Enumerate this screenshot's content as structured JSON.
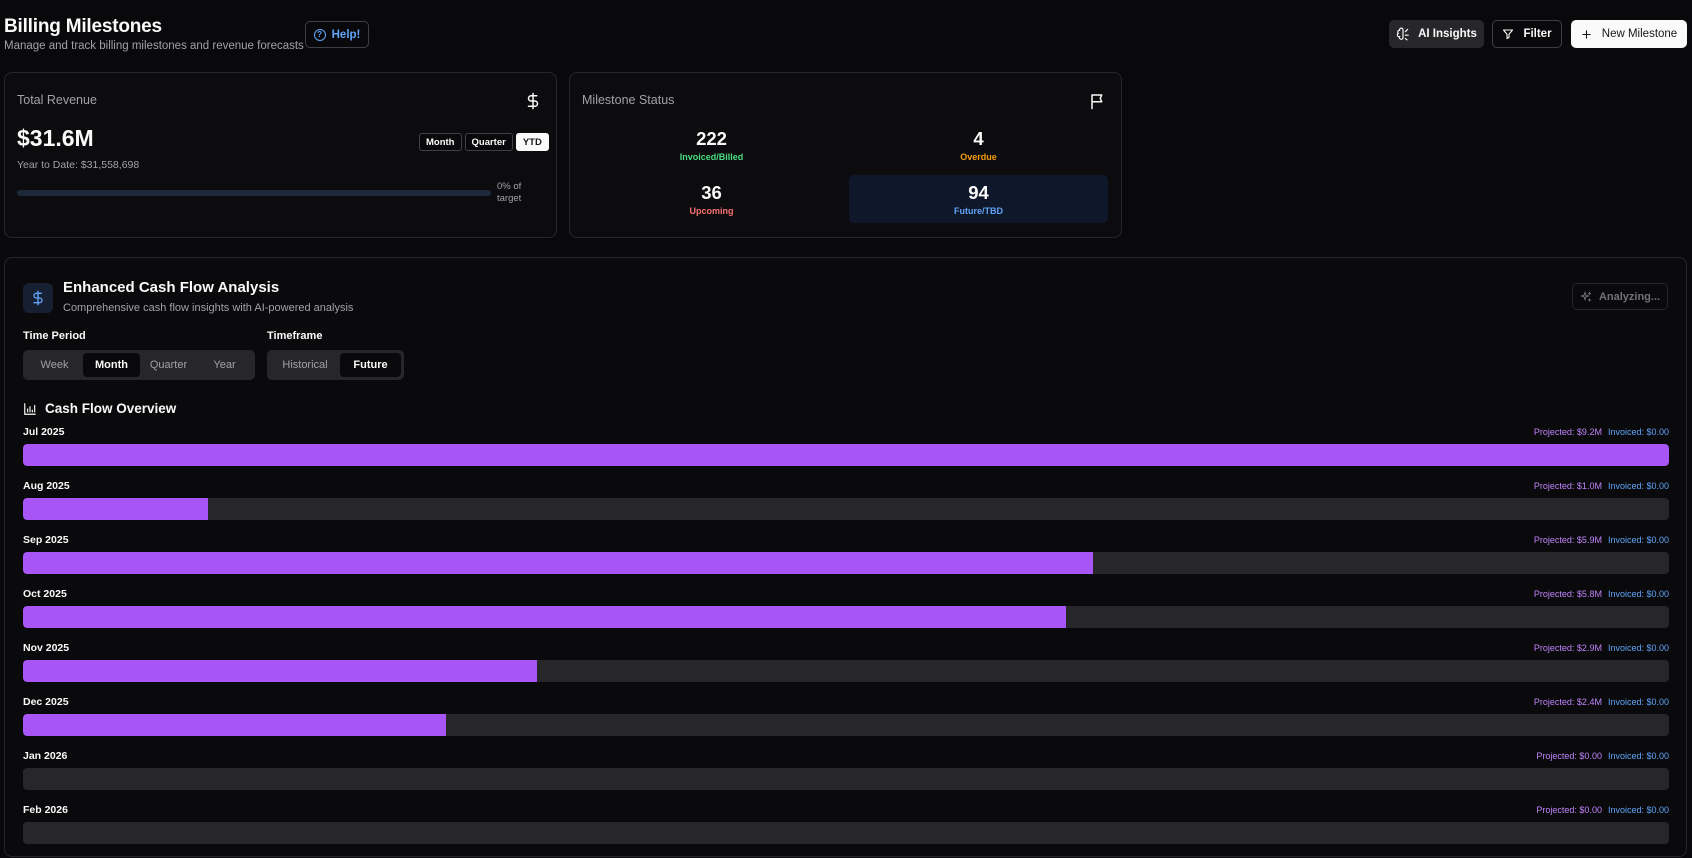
{
  "header": {
    "title": "Billing Milestones",
    "subtitle": "Manage and track billing milestones and revenue forecasts",
    "help_label": "Help!",
    "ai_insights_label": "AI Insights",
    "filter_label": "Filter",
    "new_milestone_label": "New Milestone"
  },
  "revenue_card": {
    "title": "Total Revenue",
    "value": "$31.6M",
    "ytd_text": "Year to Date: $31,558,698",
    "periods": [
      "Month",
      "Quarter",
      "YTD"
    ],
    "active_period": "YTD",
    "progress_fraction": 0,
    "target_text": "0% of target"
  },
  "status_card": {
    "title": "Milestone Status",
    "stats": [
      {
        "count": "222",
        "label": "Invoiced/Billed",
        "color": "#4ade80"
      },
      {
        "count": "4",
        "label": "Overdue",
        "color": "#f59e0b"
      },
      {
        "count": "36",
        "label": "Upcoming",
        "color": "#f87171"
      },
      {
        "count": "94",
        "label": "Future/TBD",
        "color": "#60a5fa"
      }
    ]
  },
  "analysis": {
    "title": "Enhanced Cash Flow Analysis",
    "subtitle": "Comprehensive cash flow insights with AI-powered analysis",
    "analyzing_label": "Analyzing...",
    "time_period_label": "Time Period",
    "time_periods": [
      "Week",
      "Month",
      "Quarter",
      "Year"
    ],
    "active_time_period": "Month",
    "timeframe_label": "Timeframe",
    "timeframes": [
      "Historical",
      "Future"
    ],
    "active_timeframe": "Future",
    "overview_title": "Cash Flow Overview"
  },
  "colors": {
    "projected": "#a855f7",
    "invoiced": "#60a5fa",
    "accent": "#3b82f6"
  },
  "chart_data": {
    "type": "bar",
    "categories": [
      "Jul 2025",
      "Aug 2025",
      "Sep 2025",
      "Oct 2025",
      "Nov 2025",
      "Dec 2025",
      "Jan 2026",
      "Feb 2026"
    ],
    "series": [
      {
        "name": "Projected",
        "values": [
          9.2,
          1.0,
          5.9,
          5.8,
          2.9,
          2.4,
          0,
          0
        ],
        "labels": [
          "Projected: $9.2M",
          "Projected: $1.0M",
          "Projected: $5.9M",
          "Projected: $5.8M",
          "Projected: $2.9M",
          "Projected: $2.4M",
          "Projected: $0.00",
          "Projected: $0.00"
        ]
      },
      {
        "name": "Invoiced",
        "values": [
          0,
          0,
          0,
          0,
          0,
          0,
          0,
          0
        ],
        "labels": [
          "Invoiced: $0.00",
          "Invoiced: $0.00",
          "Invoiced: $0.00",
          "Invoiced: $0.00",
          "Invoiced: $0.00",
          "Invoiced: $0.00",
          "Invoiced: $0.00",
          "Invoiced: $0.00"
        ]
      }
    ],
    "fill_fractions": [
      1.0,
      0.1125,
      0.65,
      0.6335,
      0.3125,
      0.257,
      0,
      0
    ]
  }
}
